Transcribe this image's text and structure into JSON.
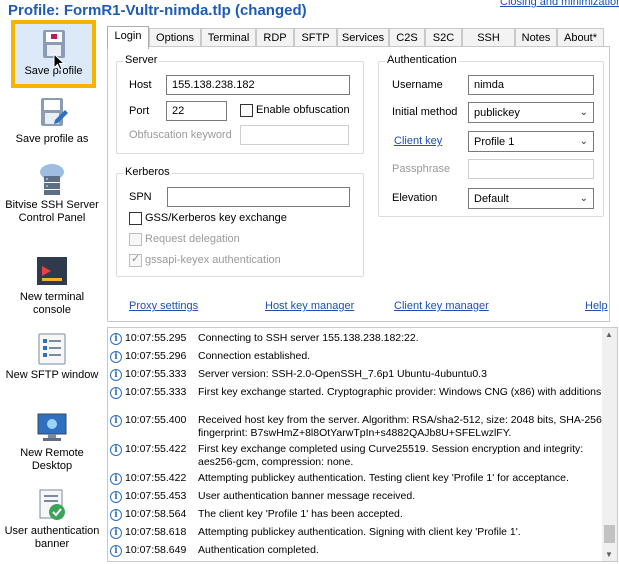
{
  "title": "Profile: FormR1-Vultr-nimda.tlp (changed)",
  "top_link": "Closing and minimization",
  "sidebar": [
    {
      "label": "Save profile",
      "icon": "save-profile-icon"
    },
    {
      "label": "Save profile as",
      "icon": "save-profile-as-icon"
    },
    {
      "label": "Bitvise SSH Server Control Panel",
      "icon": "server-control-icon"
    },
    {
      "label": "New terminal console",
      "icon": "terminal-icon"
    },
    {
      "label": "New SFTP window",
      "icon": "sftp-icon"
    },
    {
      "label": "New Remote Desktop",
      "icon": "remote-desktop-icon"
    },
    {
      "label": "User authentication banner",
      "icon": "auth-banner-icon"
    }
  ],
  "tabs": [
    "Login",
    "Options",
    "Terminal",
    "RDP",
    "SFTP",
    "Services",
    "C2S",
    "S2C",
    "SSH",
    "Notes",
    "About*"
  ],
  "active_tab": "Login",
  "server": {
    "title": "Server",
    "host_label": "Host",
    "host_value": "155.138.238.182",
    "port_label": "Port",
    "port_value": "22",
    "obfuscation_label": "Enable obfuscation",
    "obf_keyword_label": "Obfuscation keyword",
    "obf_keyword_value": ""
  },
  "kerberos": {
    "title": "Kerberos",
    "spn_label": "SPN",
    "spn_value": "",
    "gss_label": "GSS/Kerberos key exchange",
    "delegation_label": "Request delegation",
    "gssapi_label": "gssapi-keyex authentication"
  },
  "auth": {
    "title": "Authentication",
    "username_label": "Username",
    "username_value": "nimda",
    "method_label": "Initial method",
    "method_value": "publickey",
    "clientkey_label": "Client key",
    "clientkey_value": "Profile 1",
    "passphrase_label": "Passphrase",
    "elevation_label": "Elevation",
    "elevation_value": "Default"
  },
  "links": {
    "proxy": "Proxy settings",
    "hostkey": "Host key manager",
    "clientkey": "Client key manager",
    "help": "Help"
  },
  "log": [
    {
      "time": "10:07:55.295",
      "msg": "Connecting to SSH server 155.138.238.182:22."
    },
    {
      "time": "10:07:55.296",
      "msg": "Connection established."
    },
    {
      "time": "10:07:55.333",
      "msg": "Server version: SSH-2.0-OpenSSH_7.6p1 Ubuntu-4ubuntu0.3"
    },
    {
      "time": "10:07:55.333",
      "msg": "First key exchange started. Cryptographic provider: Windows CNG (x86) with additions"
    },
    {
      "time": "10:07:55.400",
      "msg": "Received host key from the server. Algorithm: RSA/sha2-512, size: 2048 bits, SHA-256 fingerprint: B7swHmZ+8l8OtYarwTpIn+s4882QAJb8U+SFELwzlFY."
    },
    {
      "time": "10:07:55.422",
      "msg": "First key exchange completed using Curve25519. Session encryption and integrity: aes256-gcm, compression: none."
    },
    {
      "time": "10:07:55.422",
      "msg": "Attempting publickey authentication. Testing client key 'Profile 1' for acceptance."
    },
    {
      "time": "10:07:55.453",
      "msg": "User authentication banner message received."
    },
    {
      "time": "10:07:58.564",
      "msg": "The client key 'Profile 1' has been accepted."
    },
    {
      "time": "10:07:58.618",
      "msg": "Attempting publickey authentication. Signing with client key 'Profile 1'."
    },
    {
      "time": "10:07:58.649",
      "msg": "Authentication completed."
    }
  ],
  "colors": {
    "title": "#1e5bb7",
    "highlight": "#f4b400",
    "link": "#1f4fb5",
    "info": "#2b6fc2"
  }
}
